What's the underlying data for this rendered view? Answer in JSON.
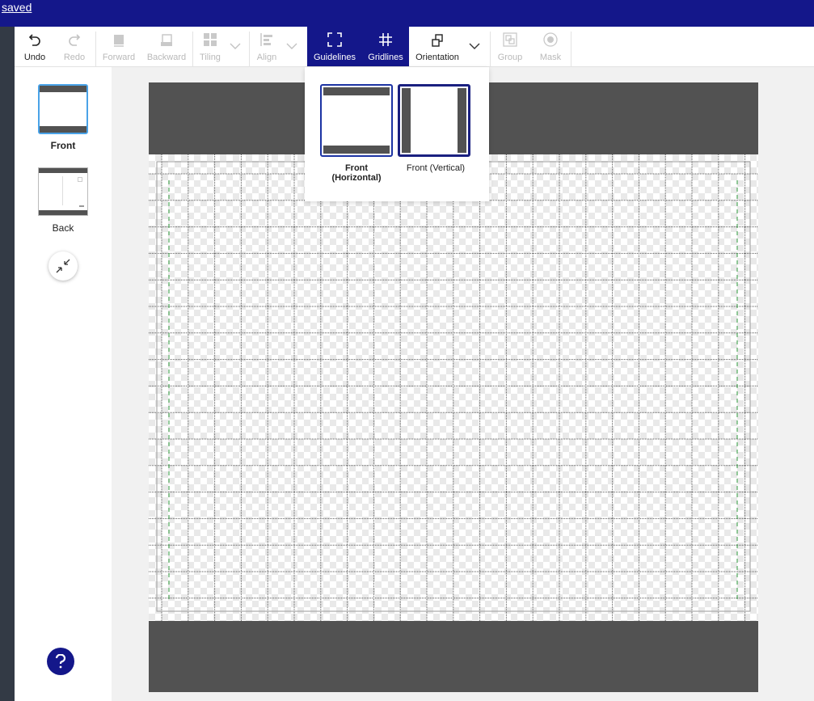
{
  "header": {
    "saved_label": "saved"
  },
  "toolbar": {
    "undo": "Undo",
    "redo": "Redo",
    "forward": "Forward",
    "backward": "Backward",
    "tiling": "Tiling",
    "align": "Align",
    "guidelines": "Guidelines",
    "gridlines": "Gridlines",
    "orientation": "Orientation",
    "group": "Group",
    "mask": "Mask"
  },
  "sidebar": {
    "pages": [
      {
        "label": "Front",
        "selected": true
      },
      {
        "label": "Back",
        "selected": false
      }
    ]
  },
  "orientation_menu": {
    "options": [
      {
        "label": "Front (Horizontal)",
        "selected": true
      },
      {
        "label": "Front (Vertical)",
        "selected": false
      }
    ]
  },
  "icons": {
    "undo": "undo-icon",
    "redo": "redo-icon",
    "forward": "bring-forward-icon",
    "backward": "send-backward-icon",
    "tiling": "tiling-icon",
    "align": "align-icon",
    "guidelines": "guidelines-icon",
    "gridlines": "gridlines-icon",
    "orientation": "orientation-icon",
    "group": "group-icon",
    "mask": "mask-icon",
    "fit": "shrink-arrows-icon",
    "help": "question-icon",
    "collapse": "chevron-left-icon"
  },
  "colors": {
    "brand": "#14178a",
    "selection": "#4aa3e8",
    "canvas_bg": "#525252",
    "guide": "#2e9a3c"
  }
}
